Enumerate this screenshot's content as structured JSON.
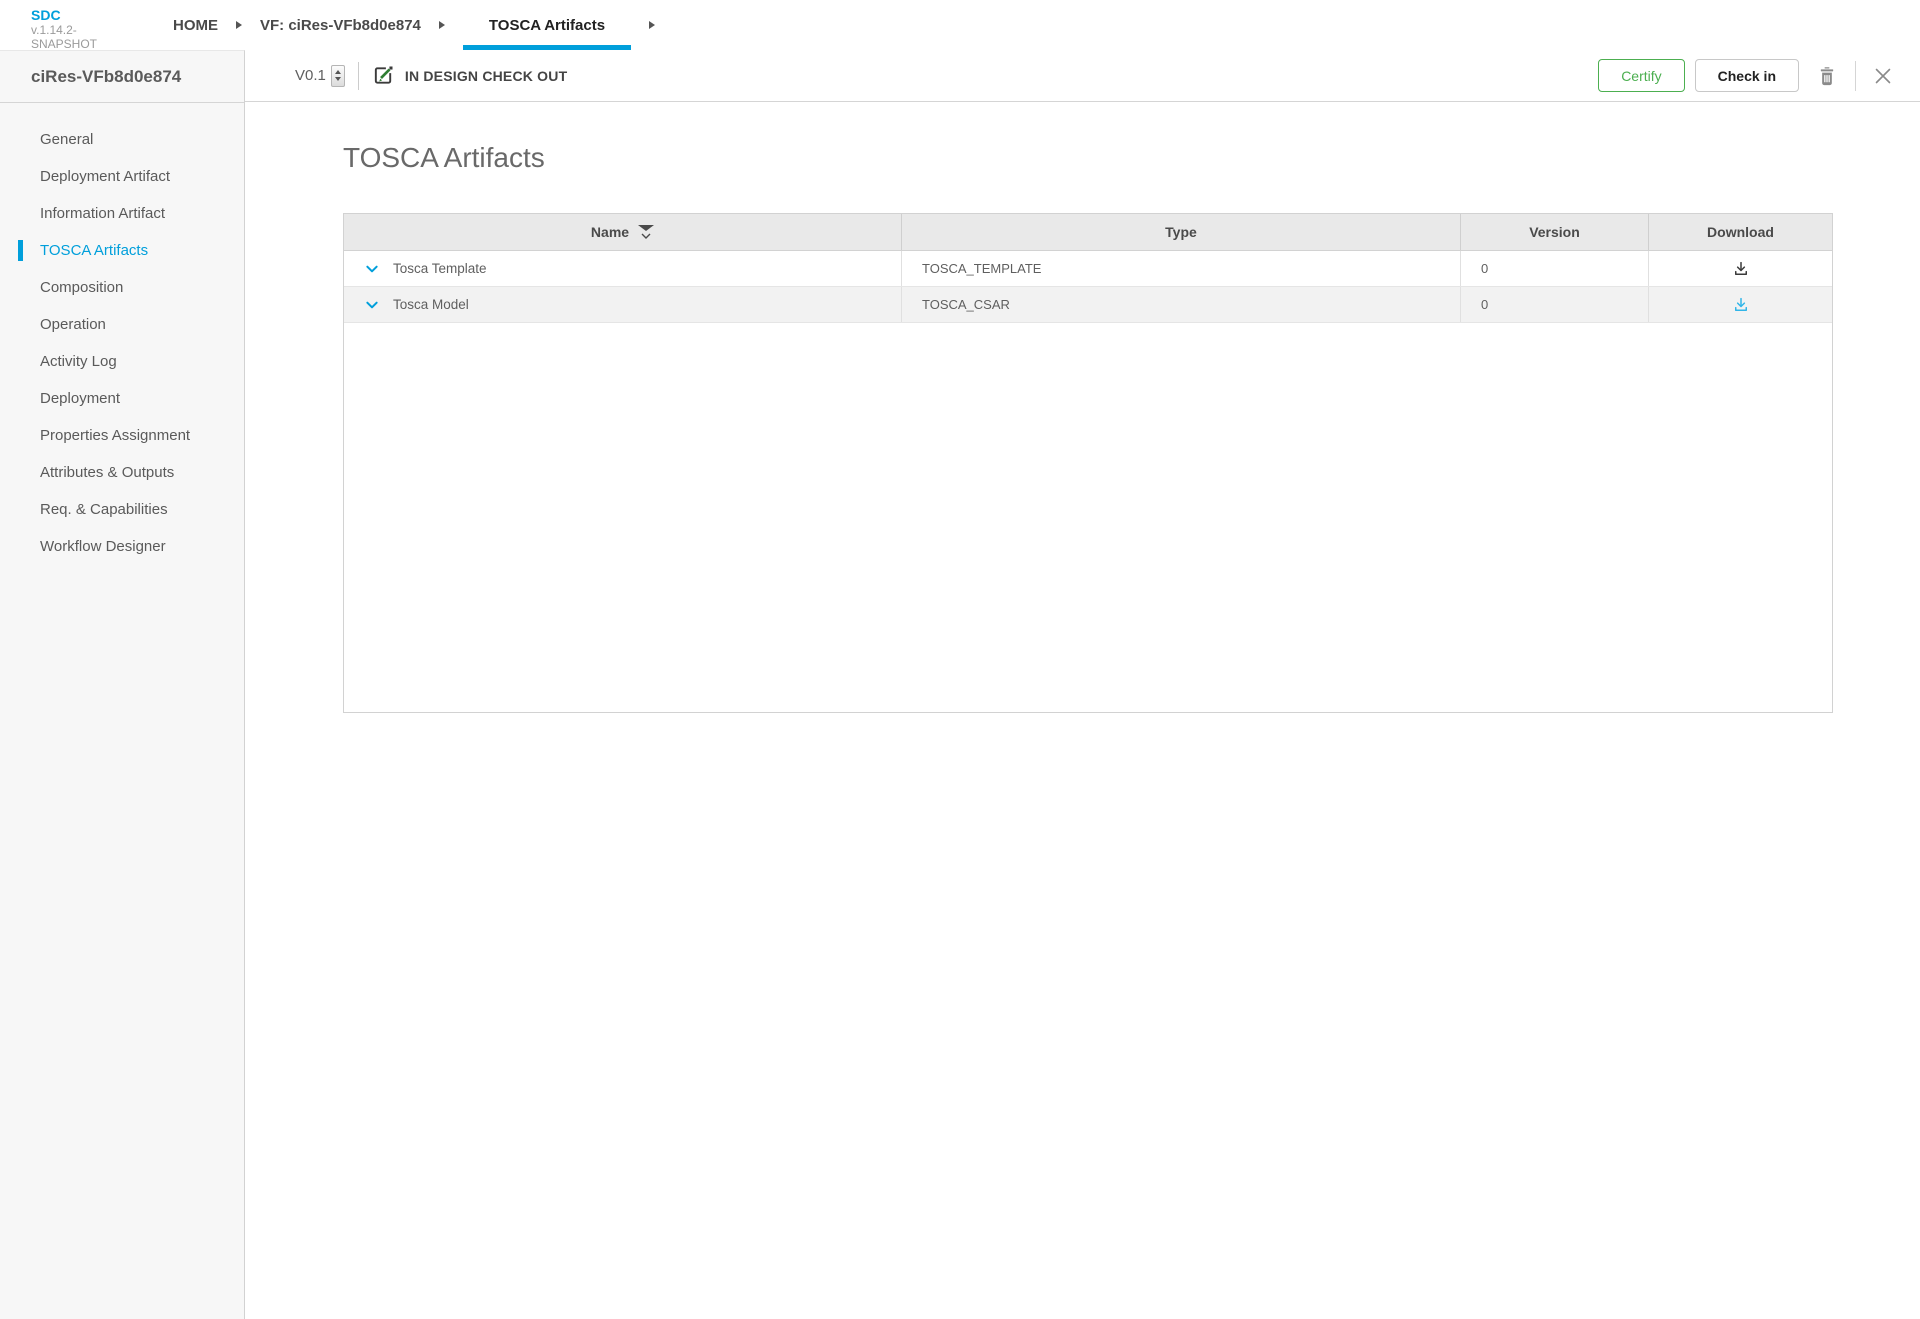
{
  "app": {
    "name": "SDC",
    "version": "v.1.14.2-SNAPSHOT"
  },
  "breadcrumbs": [
    {
      "label": "HOME",
      "active": false
    },
    {
      "label": "VF: ciRes-VFb8d0e874",
      "active": false
    },
    {
      "label": "TOSCA Artifacts",
      "active": true
    }
  ],
  "toolbar": {
    "version": "V0.1",
    "state_label": "IN DESIGN CHECK OUT",
    "state_icon": "edit-pencil-icon",
    "certify_label": "Certify",
    "check_in_label": "Check in",
    "icons": [
      "delete-icon",
      "close-icon"
    ]
  },
  "sidebar": {
    "title": "ciRes-VFb8d0e874",
    "items": [
      {
        "label": "General",
        "active": false
      },
      {
        "label": "Deployment Artifact",
        "active": false
      },
      {
        "label": "Information Artifact",
        "active": false
      },
      {
        "label": "TOSCA Artifacts",
        "active": true
      },
      {
        "label": "Composition",
        "active": false
      },
      {
        "label": "Operation",
        "active": false
      },
      {
        "label": "Activity Log",
        "active": false
      },
      {
        "label": "Deployment",
        "active": false
      },
      {
        "label": "Properties Assignment",
        "active": false
      },
      {
        "label": "Attributes & Outputs",
        "active": false
      },
      {
        "label": "Req. & Capabilities",
        "active": false
      },
      {
        "label": "Workflow Designer",
        "active": false
      }
    ]
  },
  "main": {
    "title": "TOSCA Artifacts",
    "table": {
      "columns": [
        "Name",
        "Type",
        "Version",
        "Download"
      ],
      "sorted_column": "Name",
      "rows": [
        {
          "name": "Tosca Template",
          "type": "TOSCA_TEMPLATE",
          "version": "0",
          "download_highlight": false
        },
        {
          "name": "Tosca Model",
          "type": "TOSCA_CSAR",
          "version": "0",
          "download_highlight": true
        }
      ]
    }
  },
  "colors": {
    "accent": "#009fdb",
    "certify_green": "#4CAF50",
    "pencil_green": "#2e7d32",
    "download_highlight": "#31b5e8"
  }
}
